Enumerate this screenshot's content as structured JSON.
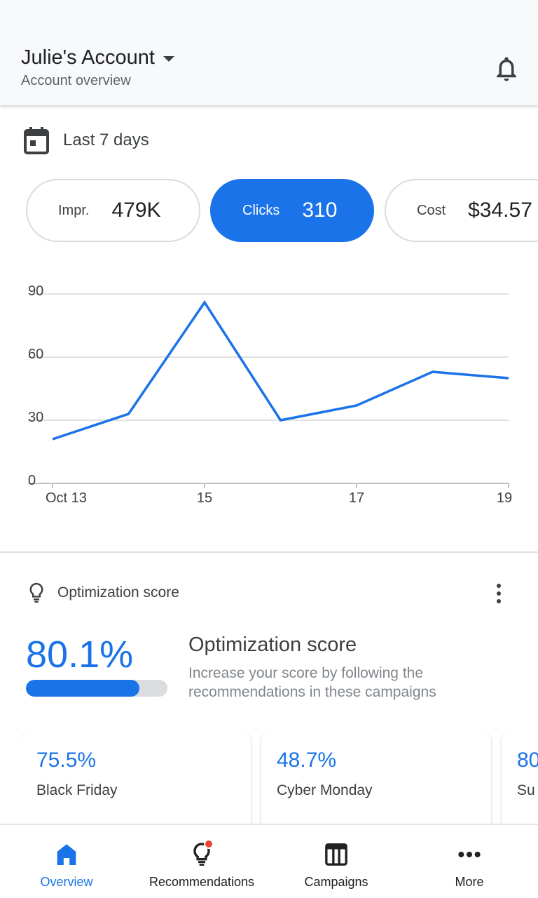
{
  "header": {
    "account_name": "Julie's Account",
    "subtitle": "Account overview",
    "bell_icon": "bell-icon",
    "caret_icon": "caret-down-icon"
  },
  "date_range": {
    "label": "Last 7 days",
    "icon": "calendar-icon"
  },
  "metrics": [
    {
      "label": "Impr.",
      "value": "479K",
      "active": false
    },
    {
      "label": "Clicks",
      "value": "310",
      "active": true
    },
    {
      "label": "Cost",
      "value": "$34.57",
      "active": false
    }
  ],
  "chart_data": {
    "type": "line",
    "x_tick_labels": [
      "Oct 13",
      "15",
      "17",
      "19"
    ],
    "x": [
      "Oct 13",
      "Oct 14",
      "Oct 15",
      "Oct 16",
      "Oct 17",
      "Oct 18",
      "Oct 19"
    ],
    "series": [
      {
        "values": [
          21,
          33,
          86,
          30,
          37,
          53,
          50
        ]
      }
    ],
    "ylim": [
      0,
      90
    ],
    "yticks": [
      0,
      30,
      60,
      90
    ],
    "grid": true,
    "color": "#1a73e8"
  },
  "optimization": {
    "section_label": "Optimization score",
    "score": "80.1%",
    "score_fraction": 0.801,
    "title": "Optimization score",
    "description": "Increase your score by following the recommendations in these campaigns",
    "bulb_icon": "lightbulb-icon",
    "menu_icon": "more-vert-icon"
  },
  "campaigns": [
    {
      "score": "75.5%",
      "name": "Black Friday"
    },
    {
      "score": "48.7%",
      "name": "Cyber Monday"
    },
    {
      "score": "80",
      "name": "Su"
    }
  ],
  "bottom_nav": [
    {
      "label": "Overview",
      "icon": "home-icon",
      "active": true
    },
    {
      "label": "Recommendations",
      "icon": "lightbulb-icon",
      "active": false,
      "badge": true
    },
    {
      "label": "Campaigns",
      "icon": "campaigns-icon",
      "active": false
    },
    {
      "label": "More",
      "icon": "more-horiz-icon",
      "active": false
    }
  ],
  "colors": {
    "accent": "#1a73e8",
    "badge": "#ea4335",
    "text": "#202124",
    "secondary_text": "#5f6368"
  }
}
